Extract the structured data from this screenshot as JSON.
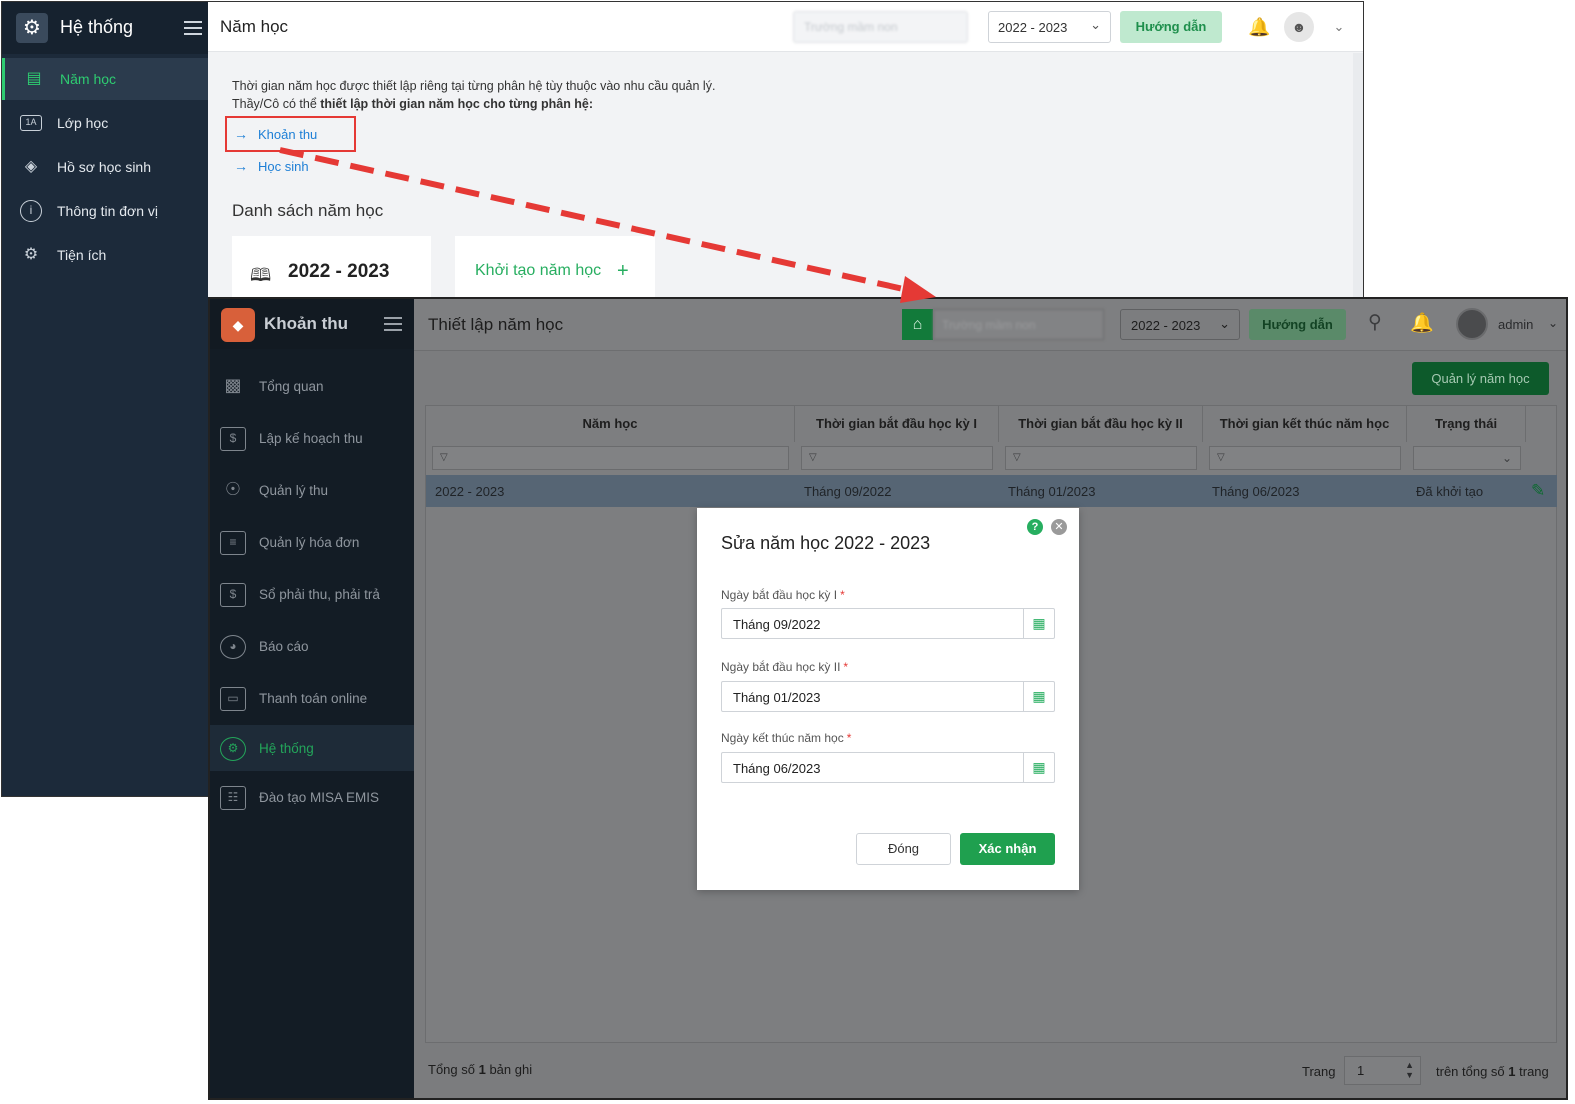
{
  "window1": {
    "sidebar_title": "Hệ thống",
    "menu": [
      {
        "label": "Năm học",
        "icon": "calendar-icon",
        "active": true
      },
      {
        "label": "Lớp học",
        "icon": "class-badge-icon",
        "active": false
      },
      {
        "label": "Hồ sơ học sinh",
        "icon": "graduation-cap-icon",
        "active": false
      },
      {
        "label": "Thông tin đơn vị",
        "icon": "info-icon",
        "active": false
      },
      {
        "label": "Tiện ích",
        "icon": "gear-icon",
        "active": false
      }
    ],
    "page_title": "Năm học",
    "school_name": "Trường mầm non",
    "year_select": "2022 - 2023",
    "guide_button": "Hướng dẫn",
    "intro_line1": "Thời gian năm học được thiết lập riêng tại từng phân hệ tùy thuộc vào nhu cầu quản lý.",
    "intro_line2_prefix": "Thầy/Cô có thể ",
    "intro_line2_bold": "thiết lập thời gian năm học cho từng phân hệ:",
    "links": [
      "Khoản thu",
      "Học sinh"
    ],
    "section_title": "Danh sách năm học",
    "year_card": "2022 - 2023",
    "create_card": "Khởi tạo năm học"
  },
  "window2": {
    "app_title": "Khoản thu",
    "menu": [
      {
        "label": "Tổng quan",
        "icon": "bar-chart-icon",
        "active": false
      },
      {
        "label": "Lập kế hoạch thu",
        "icon": "planning-icon",
        "active": false
      },
      {
        "label": "Quản lý thu",
        "icon": "hand-coin-icon",
        "active": false
      },
      {
        "label": "Quản lý hóa đơn",
        "icon": "invoice-icon",
        "active": false
      },
      {
        "label": "Sổ phải thu, phải trả",
        "icon": "ledger-icon",
        "active": false
      },
      {
        "label": "Báo cáo",
        "icon": "pie-chart-icon",
        "active": false
      },
      {
        "label": "Thanh toán online",
        "icon": "card-icon",
        "active": false
      },
      {
        "label": "Hệ thống",
        "icon": "gear-icon",
        "active": true
      },
      {
        "label": "Đào tạo MISA EMIS",
        "icon": "book-icon",
        "active": false
      }
    ],
    "page_title": "Thiết lập năm học",
    "school_name": "Trường mầm non",
    "year_select": "2022 - 2023",
    "guide_button": "Hướng dẫn",
    "user": "admin",
    "manage_button": "Quản lý năm học",
    "table": {
      "columns": [
        "Năm học",
        "Thời gian bắt đầu học kỳ I",
        "Thời gian bắt đầu học kỳ II",
        "Thời gian kết thúc năm học",
        "Trạng thái"
      ],
      "rows": [
        [
          "2022 - 2023",
          "Tháng 09/2022",
          "Tháng 01/2023",
          "Tháng 06/2023",
          "Đã khởi tạo"
        ]
      ]
    },
    "footer_total_prefix": "Tổng số ",
    "footer_total_count": "1",
    "footer_total_suffix": " bản ghi",
    "page_label": "Trang",
    "page_value": "1",
    "page_total_prefix": "trên tổng số ",
    "page_total_count": "1",
    "page_total_suffix": " trang"
  },
  "dialog": {
    "title": "Sửa năm học 2022 - 2023",
    "fields": [
      {
        "label": "Ngày bắt đầu học kỳ I",
        "value": "Tháng 09/2022"
      },
      {
        "label": "Ngày bắt đầu học kỳ II",
        "value": "Tháng 01/2023"
      },
      {
        "label": "Ngày kết thúc năm học",
        "value": "Tháng 06/2023"
      }
    ],
    "required_mark": "*",
    "cancel_button": "Đóng",
    "confirm_button": "Xác nhận"
  },
  "colors": {
    "accent_green": "#27ae60",
    "highlight_red": "#e53935",
    "link_blue": "#1e7fd6",
    "sidebar_dark": "#1c2a3a"
  }
}
